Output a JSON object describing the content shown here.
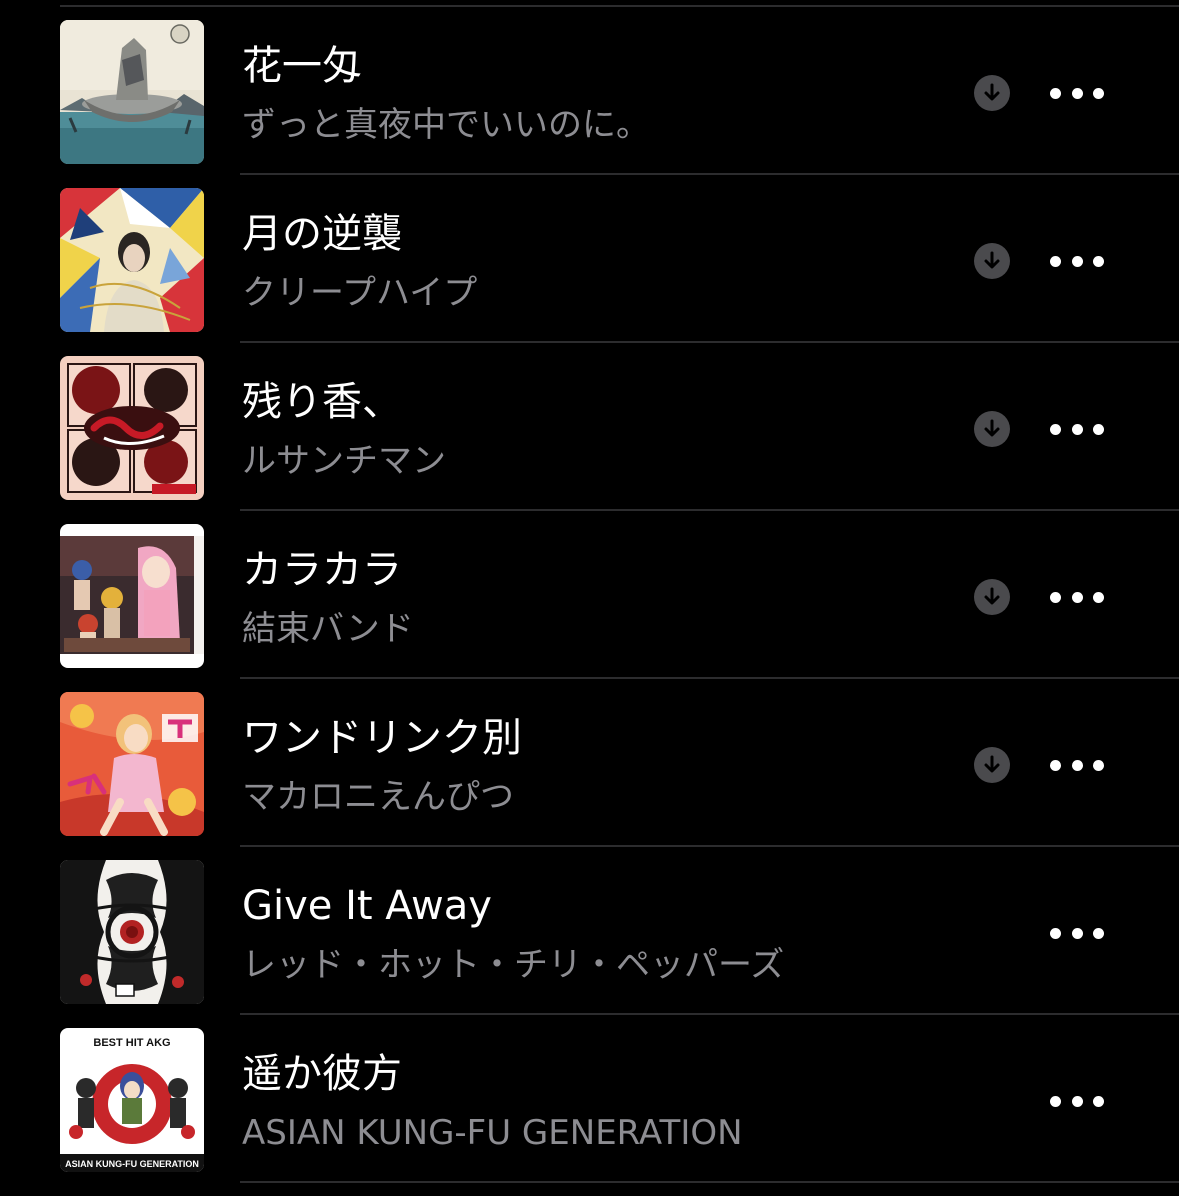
{
  "tracks": [
    {
      "title": "花一匁",
      "artist": "ずっと真夜中でいいのに。",
      "artwork_icon": "album-artwork-ship-on-sea",
      "downloadable": true
    },
    {
      "title": "月の逆襲",
      "artist": "クリープハイプ",
      "artwork_icon": "album-artwork-geometric-portrait",
      "downloadable": true
    },
    {
      "title": "残り香、",
      "artist": "ルサンチマン",
      "artwork_icon": "album-artwork-red-figures",
      "downloadable": true
    },
    {
      "title": "カラカラ",
      "artist": "結束バンド",
      "artwork_icon": "album-artwork-anime-band",
      "downloadable": true
    },
    {
      "title": "ワンドリンク別",
      "artist": "マカロニえんぴつ",
      "artwork_icon": "album-artwork-pink-illustration",
      "downloadable": true
    },
    {
      "title": "Give It Away",
      "artist": "レッド・ホット・チリ・ペッパーズ",
      "artwork_icon": "album-artwork-black-white-faces",
      "downloadable": false
    },
    {
      "title": "遥か彼方",
      "artist": "ASIAN KUNG-FU GENERATION",
      "artwork_icon": "album-artwork-best-hit-akg",
      "downloadable": false,
      "artwork_text": [
        "BEST HIT AKG",
        "ASIAN KUNG-FU GENERATION"
      ]
    }
  ],
  "icons": {
    "download": "download-arrow-icon",
    "more": "ellipsis-more-icon"
  },
  "colors": {
    "background": "#000000",
    "title": "#ffffff",
    "artist": "#8d8d92",
    "divider": "#2c2c2e",
    "download_circle": "#4a4a4d"
  }
}
